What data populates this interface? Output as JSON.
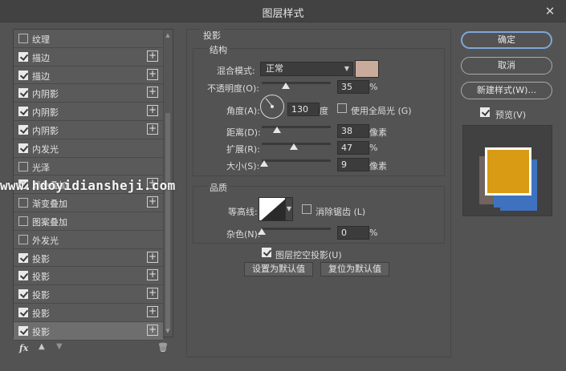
{
  "window": {
    "title": "图层样式",
    "close": "✕"
  },
  "styles": [
    {
      "label": "纹理",
      "checked": false,
      "plus": false
    },
    {
      "label": "描边",
      "checked": true,
      "plus": true
    },
    {
      "label": "描边",
      "checked": true,
      "plus": true
    },
    {
      "label": "内阴影",
      "checked": true,
      "plus": true
    },
    {
      "label": "内阴影",
      "checked": true,
      "plus": true
    },
    {
      "label": "内阴影",
      "checked": true,
      "plus": true
    },
    {
      "label": "内发光",
      "checked": true,
      "plus": false
    },
    {
      "label": "光泽",
      "checked": false,
      "plus": false
    },
    {
      "label": "颜色叠加",
      "checked": true,
      "plus": true
    },
    {
      "label": "渐变叠加",
      "checked": false,
      "plus": true
    },
    {
      "label": "图案叠加",
      "checked": false,
      "plus": false
    },
    {
      "label": "外发光",
      "checked": false,
      "plus": false
    },
    {
      "label": "投影",
      "checked": true,
      "plus": true
    },
    {
      "label": "投影",
      "checked": true,
      "plus": true
    },
    {
      "label": "投影",
      "checked": true,
      "plus": true
    },
    {
      "label": "投影",
      "checked": true,
      "plus": true
    },
    {
      "label": "投影",
      "checked": true,
      "plus": true,
      "selected": true
    }
  ],
  "tools": {
    "fx": "fx",
    "up": "▲",
    "down": "▼",
    "trash": "🗑"
  },
  "panel": {
    "section": "投影",
    "structure": "结构",
    "blend_mode_label": "混合模式:",
    "blend_mode_value": "正常",
    "shadow_color": "#c9ab9c",
    "opacity_label": "不透明度(O):",
    "opacity_value": "35",
    "opacity_pct": 35,
    "angle_label": "角度(A):",
    "angle_value": "130",
    "angle_unit": "度",
    "global_light_label": "使用全局光 (G)",
    "global_light_checked": false,
    "distance_label": "距离(D):",
    "distance_value": "38",
    "distance_unit": "像素",
    "distance_pct": 0.22,
    "spread_label": "扩展(R):",
    "spread_value": "47",
    "spread_pct": 47,
    "size_label": "大小(S):",
    "size_value": "9",
    "size_unit": "像素",
    "size_pct": 0.03,
    "quality": "品质",
    "contour_label": "等高线:",
    "antialias_label": "消除锯齿 (L)",
    "antialias_checked": false,
    "noise_label": "杂色(N):",
    "noise_value": "0",
    "noise_pct": 0,
    "pct": "%",
    "knockout_label": "图层挖空投影(U)",
    "knockout_checked": true,
    "set_default": "设置为默认值",
    "reset_default": "复位为默认值"
  },
  "buttons": {
    "ok": "确定",
    "cancel": "取消",
    "new_style": "新建样式(W)...",
    "preview_label": "预览(V)",
    "preview_checked": true
  },
  "preview_colors": {
    "front": "#d99a14",
    "blue": "#3e72be",
    "tan": "#6f6460"
  },
  "watermark": "www.hdoyidiansheji.com"
}
